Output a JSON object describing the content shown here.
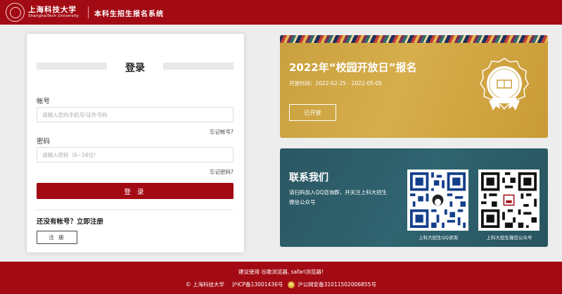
{
  "header": {
    "university_cn": "上海科技大学",
    "university_en": "ShanghaiTech University",
    "system_name": "本科生招生报名系统",
    "brand_color": "#a30b14"
  },
  "login": {
    "title": "登录",
    "account_label": "帐号",
    "account_placeholder": "请输入您的手机号/证件号码",
    "account_value": "",
    "forgot_account": "忘记帐号?",
    "password_label": "密码",
    "password_placeholder": "请输入密码（6~16位）",
    "password_value": "",
    "forgot_password": "忘记密码?",
    "login_button": "登 录",
    "no_account_text": "还没有帐号？立即注册",
    "register_button": "注 册"
  },
  "open_day": {
    "title": "2022年“校园开放日”报名",
    "time_text": "开放时间：2022-02-25 - 2022-05-05",
    "status_button": "已开放",
    "icon": "university-badge-icon",
    "bg_color": "#c9a03e"
  },
  "contact": {
    "title": "联系我们",
    "description": "请扫码加入QQ咨询群，并关注上科大招生微信公众号",
    "qr_qq_caption": "上科大招生QQ咨询",
    "qr_wechat_caption": "上科大招生微信公众号",
    "bg_color": "#2b5763"
  },
  "footer": {
    "browser_tip": "建议使用 谷歌浏览器, safari浏览器!",
    "copyright": "© 上海科技大学",
    "icp": "沪ICP备13001436号",
    "police": "沪公网安备31011502006855号",
    "icon": "police-badge-icon"
  }
}
